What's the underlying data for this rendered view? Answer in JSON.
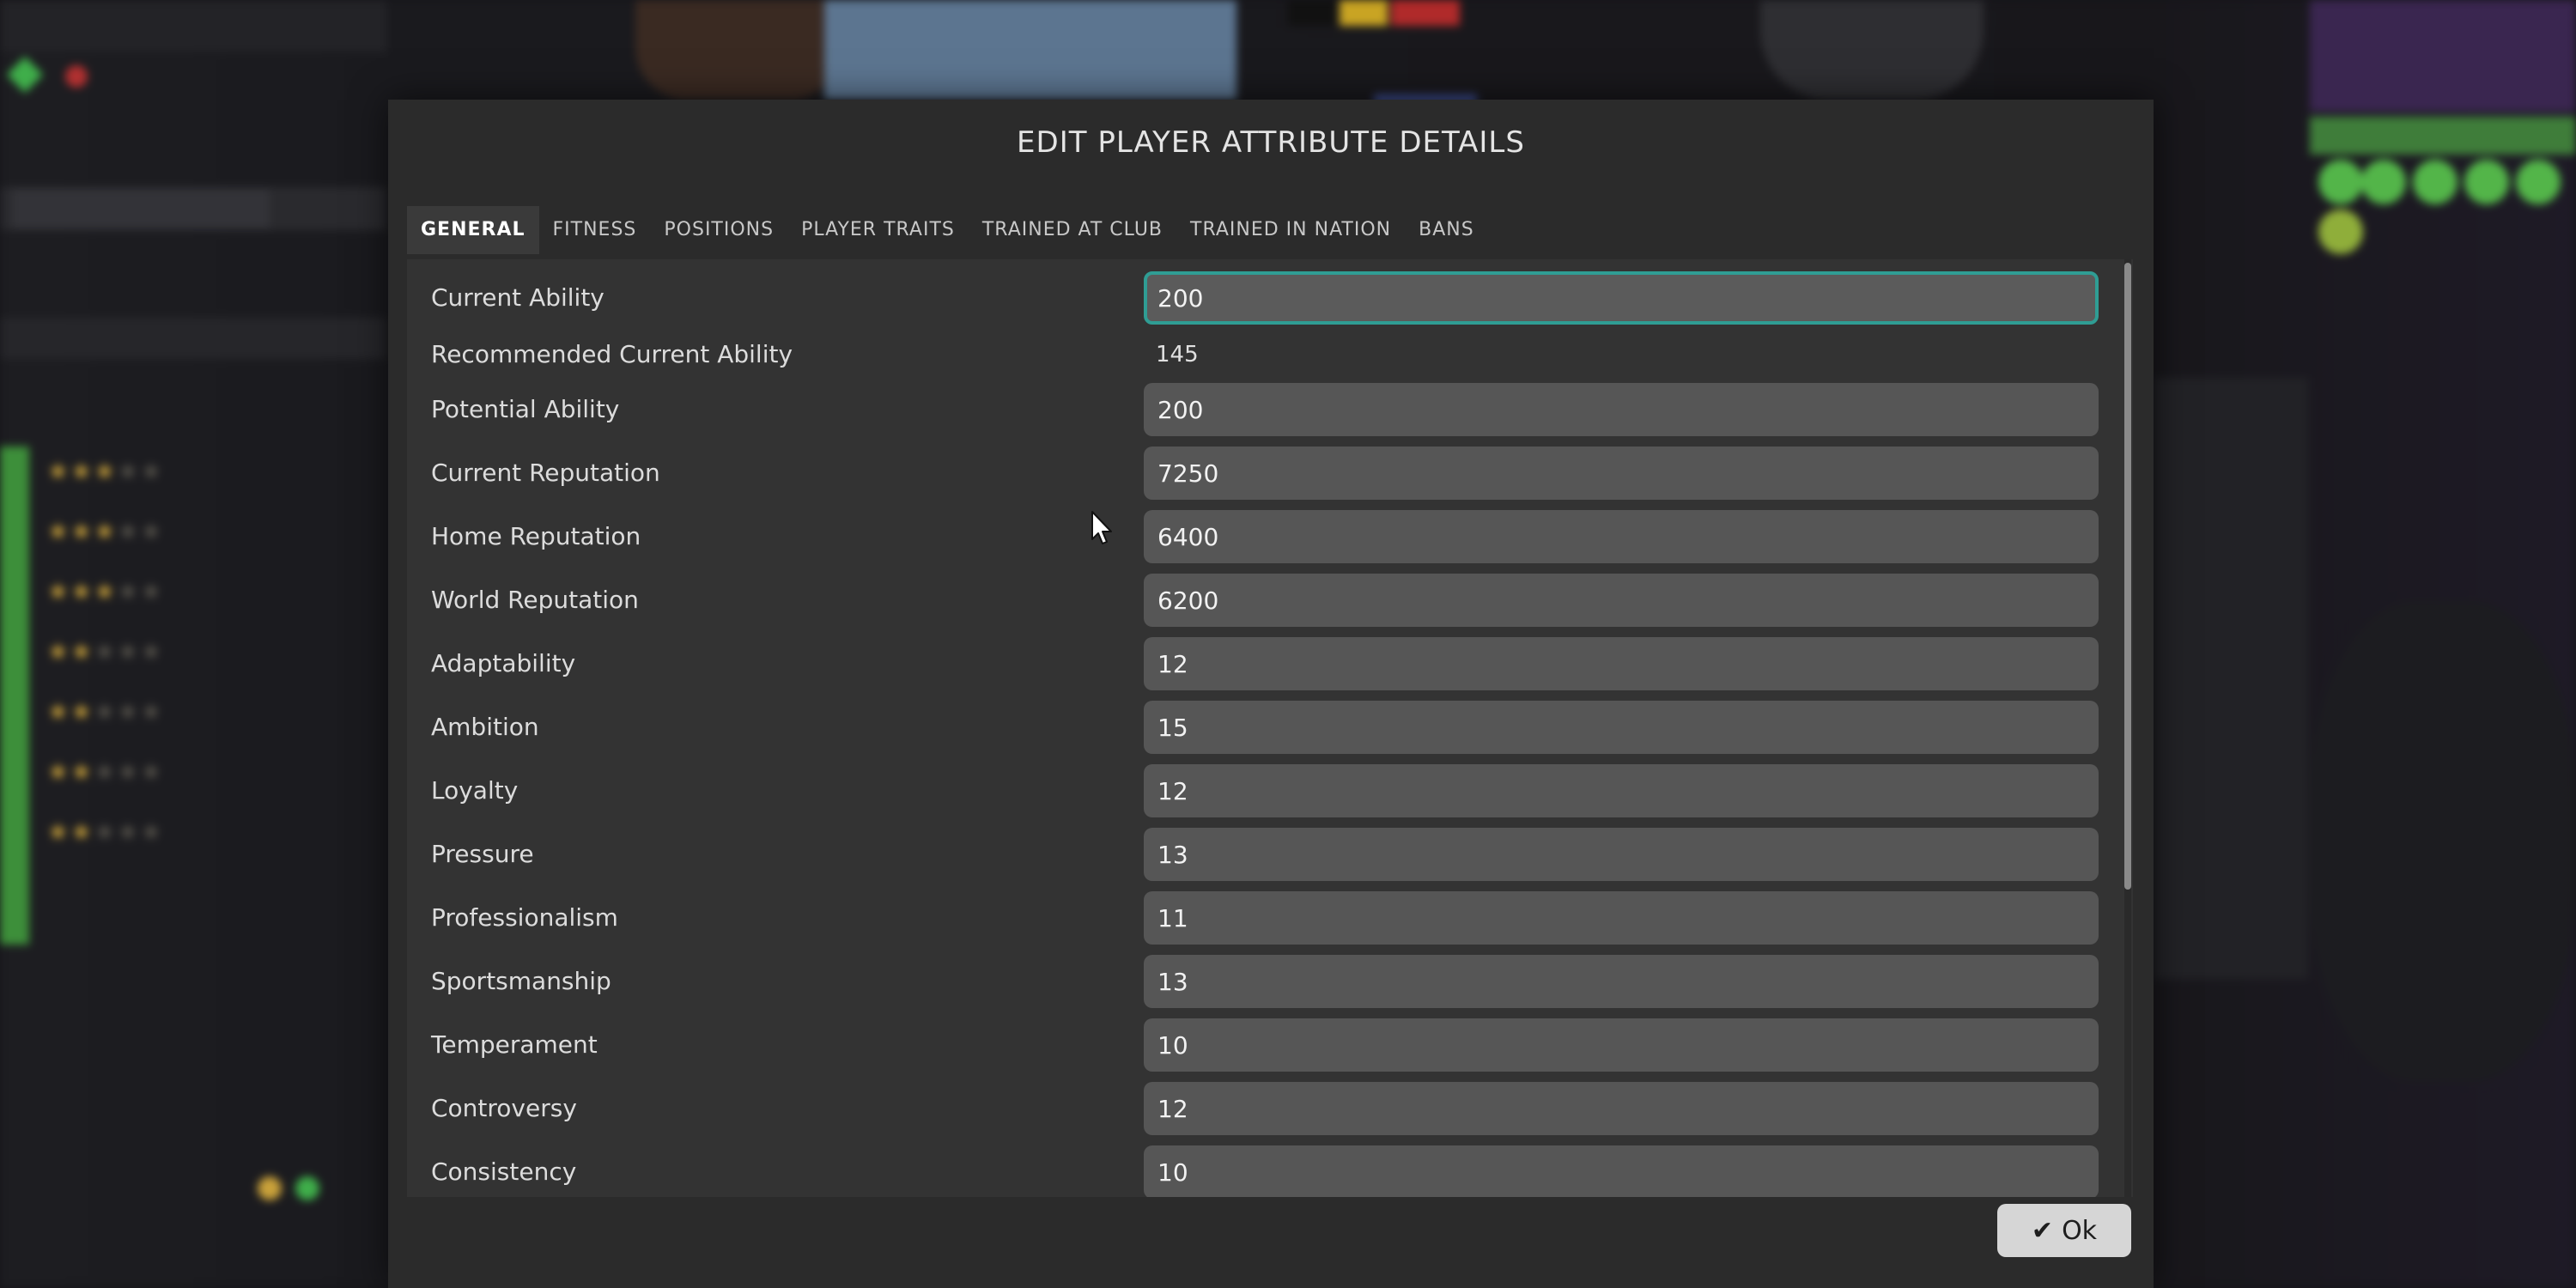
{
  "dialog": {
    "title": "EDIT PLAYER ATTRIBUTE DETAILS",
    "tabs": [
      {
        "label": "GENERAL",
        "active": true
      },
      {
        "label": "FITNESS",
        "active": false
      },
      {
        "label": "POSITIONS",
        "active": false
      },
      {
        "label": "PLAYER TRAITS",
        "active": false
      },
      {
        "label": "TRAINED AT CLUB",
        "active": false
      },
      {
        "label": "TRAINED IN NATION",
        "active": false
      },
      {
        "label": "BANS",
        "active": false
      }
    ],
    "attributes": [
      {
        "label": "Current Ability",
        "value": "200",
        "type": "input",
        "focused": true
      },
      {
        "label": "Recommended Current Ability",
        "value": "145",
        "type": "static"
      },
      {
        "label": "Potential Ability",
        "value": "200",
        "type": "input"
      },
      {
        "label": "Current Reputation",
        "value": "7250",
        "type": "input"
      },
      {
        "label": "Home Reputation",
        "value": "6400",
        "type": "input"
      },
      {
        "label": "World Reputation",
        "value": "6200",
        "type": "input"
      },
      {
        "label": "Adaptability",
        "value": "12",
        "type": "input"
      },
      {
        "label": "Ambition",
        "value": "15",
        "type": "input"
      },
      {
        "label": "Loyalty",
        "value": "12",
        "type": "input"
      },
      {
        "label": "Pressure",
        "value": "13",
        "type": "input"
      },
      {
        "label": "Professionalism",
        "value": "11",
        "type": "input"
      },
      {
        "label": "Sportsmanship",
        "value": "13",
        "type": "input"
      },
      {
        "label": "Temperament",
        "value": "10",
        "type": "input"
      },
      {
        "label": "Controversy",
        "value": "12",
        "type": "input"
      },
      {
        "label": "Consistency",
        "value": "10",
        "type": "input"
      }
    ],
    "ok_label": "Ok"
  },
  "colors": {
    "modal_bg": "#2b2b2b",
    "panel_bg": "#333333",
    "input_bg": "#565656",
    "focus_border": "#2f9d94",
    "ok_button_bg": "#d6d6d6"
  },
  "icons": {
    "ok": "check-icon",
    "cursor": "mouse-pointer-icon"
  }
}
